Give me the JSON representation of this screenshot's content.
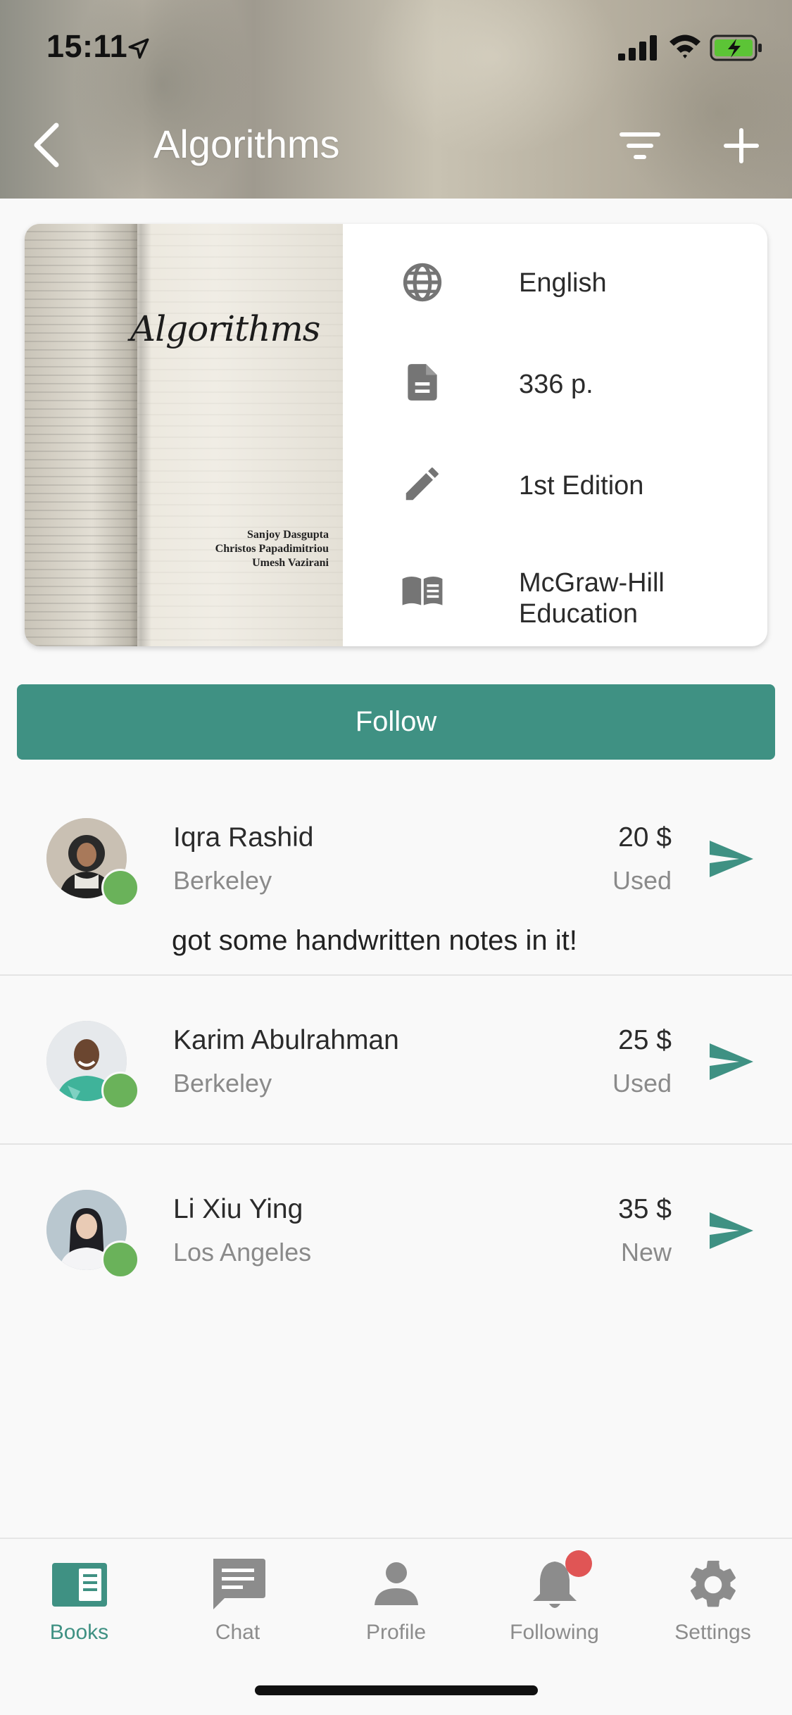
{
  "status_bar": {
    "time": "15:11"
  },
  "header": {
    "title": "Algorithms",
    "icons": {
      "back": "chevron-left-icon",
      "filter": "filter-icon",
      "add": "plus-icon"
    }
  },
  "book": {
    "cover_title": "Algorithms",
    "cover_authors": [
      "Sanjoy Dasgupta",
      "Christos Papadimitriou",
      "Umesh Vazirani"
    ],
    "language": "English",
    "pages": "336 p.",
    "edition": "1st Edition",
    "publisher_line1": "McGraw-Hill",
    "publisher_line2": "Education"
  },
  "follow_button": {
    "label": "Follow"
  },
  "listings": [
    {
      "name": "Iqra Rashid",
      "city": "Berkeley",
      "price": "20 $",
      "condition": "Used",
      "comment": "got some handwritten notes in it!",
      "online": true
    },
    {
      "name": "Karim Abulrahman",
      "city": "Berkeley",
      "price": "25 $",
      "condition": "Used",
      "online": true
    },
    {
      "name": "Li Xiu Ying",
      "city": "Los Angeles",
      "price": "35 $",
      "condition": "New",
      "online": true
    }
  ],
  "tabs": [
    {
      "label": "Books",
      "icon": "books-icon",
      "active": true
    },
    {
      "label": "Chat",
      "icon": "chat-icon",
      "active": false
    },
    {
      "label": "Profile",
      "icon": "person-icon",
      "active": false
    },
    {
      "label": "Following",
      "icon": "bell-icon",
      "active": false,
      "badge": true
    },
    {
      "label": "Settings",
      "icon": "gear-icon",
      "active": false
    }
  ],
  "colors": {
    "accent": "#3f9183",
    "online": "#6ab25a",
    "badge": "#e05555",
    "muted_text": "#8a8a8a"
  }
}
